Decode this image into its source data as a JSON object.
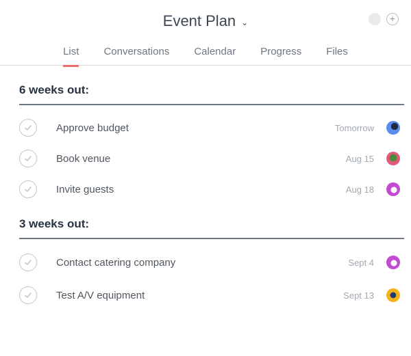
{
  "header": {
    "title": "Event Plan",
    "title_chevron": "⌄",
    "add_label": "+"
  },
  "tabs": [
    {
      "label": "List",
      "active": true
    },
    {
      "label": "Conversations",
      "active": false
    },
    {
      "label": "Calendar",
      "active": false
    },
    {
      "label": "Progress",
      "active": false
    },
    {
      "label": "Files",
      "active": false
    }
  ],
  "sections": [
    {
      "title": "6 weeks out:",
      "tasks": [
        {
          "name": "Approve budget",
          "due": "Tomorrow",
          "avatar_color": "#5b8def"
        },
        {
          "name": "Book venue",
          "due": "Aug 15",
          "avatar_color": "#e05b7a"
        },
        {
          "name": "Invite guests",
          "due": "Aug 18",
          "avatar_color": "#c14bd1"
        }
      ]
    },
    {
      "title": "3 weeks out:",
      "tasks": [
        {
          "name": "Contact catering company",
          "due": "Sept  4",
          "avatar_color": "#c14bd1"
        },
        {
          "name": "Test A/V equipment",
          "due": "Sept 13",
          "avatar_color": "#f3b21b"
        }
      ]
    }
  ],
  "colors": {
    "accent": "#f06a6a",
    "divider": "#6f7782"
  }
}
